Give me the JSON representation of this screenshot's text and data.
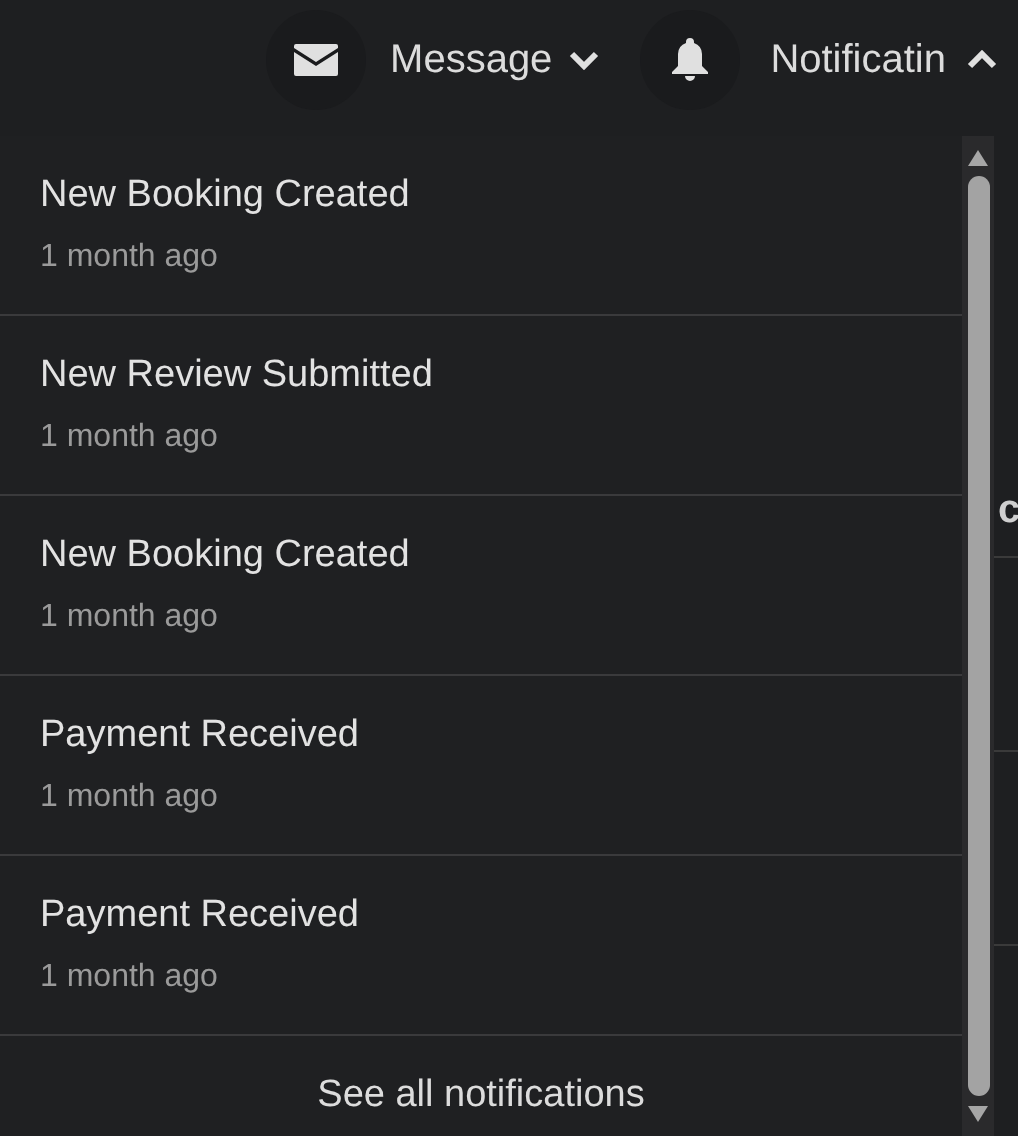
{
  "header": {
    "message": {
      "label": "Message",
      "expanded": false
    },
    "notifications": {
      "label": "Notificatin",
      "expanded": true
    }
  },
  "background_text": "c",
  "notifications": [
    {
      "title": "New Booking Created",
      "time": "1 month ago"
    },
    {
      "title": "New Review Submitted",
      "time": "1 month ago"
    },
    {
      "title": "New Booking Created",
      "time": "1 month ago"
    },
    {
      "title": "Payment Received",
      "time": "1 month ago"
    },
    {
      "title": "Payment Received",
      "time": "1 month ago"
    }
  ],
  "footer_link": "See all notifications"
}
